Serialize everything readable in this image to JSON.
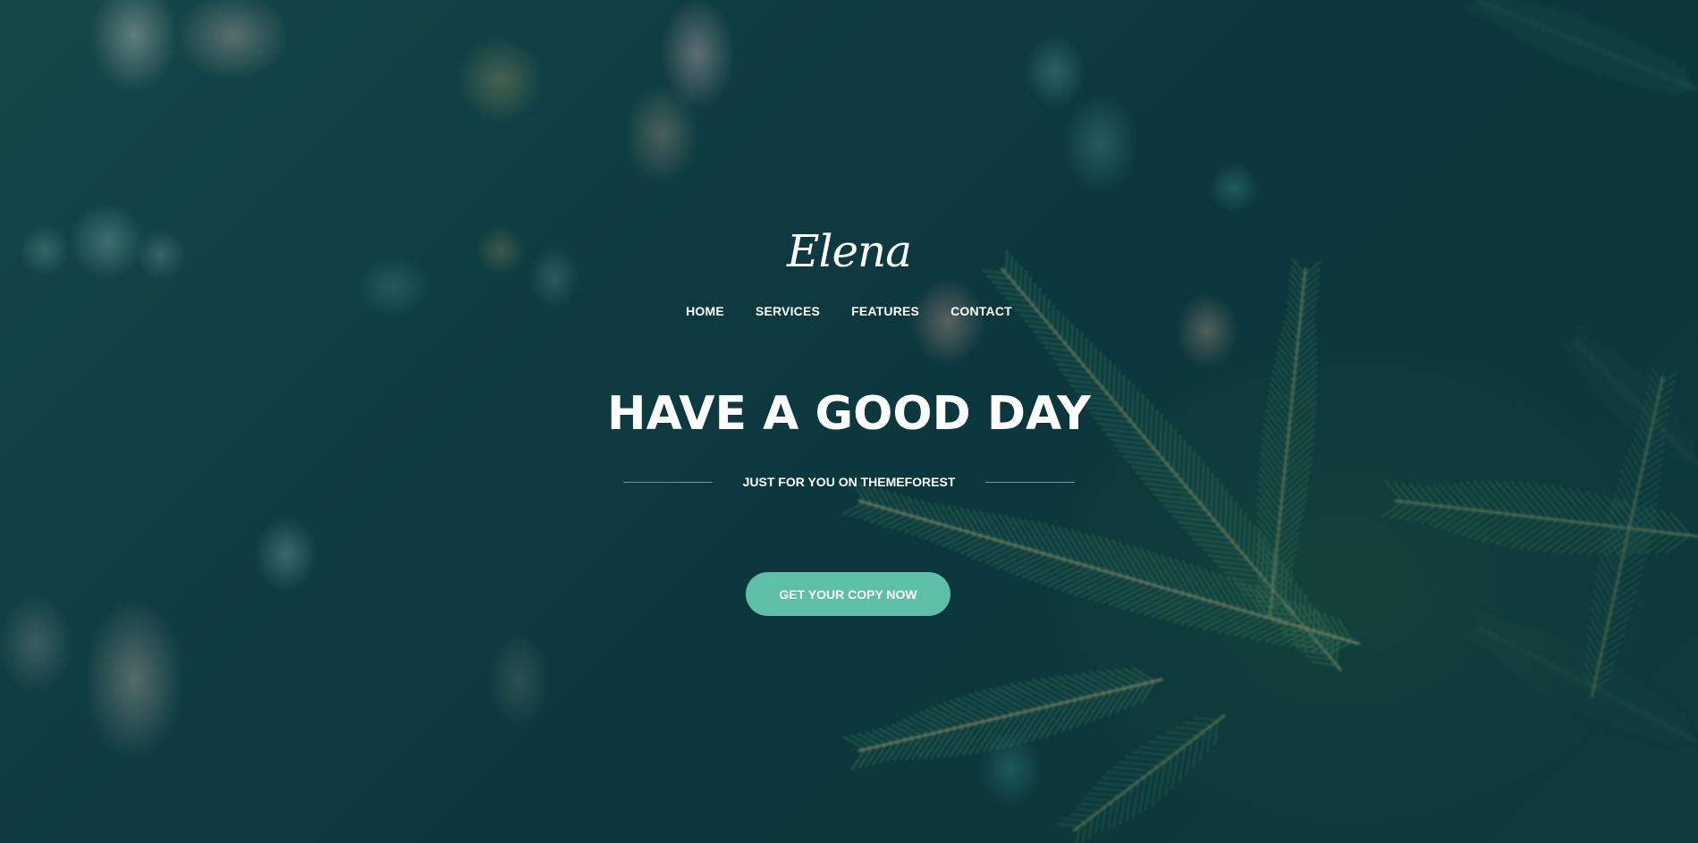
{
  "brand": {
    "logo_text": "Elena"
  },
  "nav": {
    "items": [
      {
        "label": "HOME"
      },
      {
        "label": "SERVICES"
      },
      {
        "label": "FEATURES"
      },
      {
        "label": "CONTACT"
      }
    ]
  },
  "hero": {
    "headline": "HAVE A GOOD DAY",
    "subheadline": "JUST FOR YOU ON THEMEFOREST",
    "cta_label": "GET YOUR COPY NOW"
  },
  "colors": {
    "background": "#0c3a3e",
    "accent": "#5ebfa9",
    "text": "#ffffff"
  }
}
